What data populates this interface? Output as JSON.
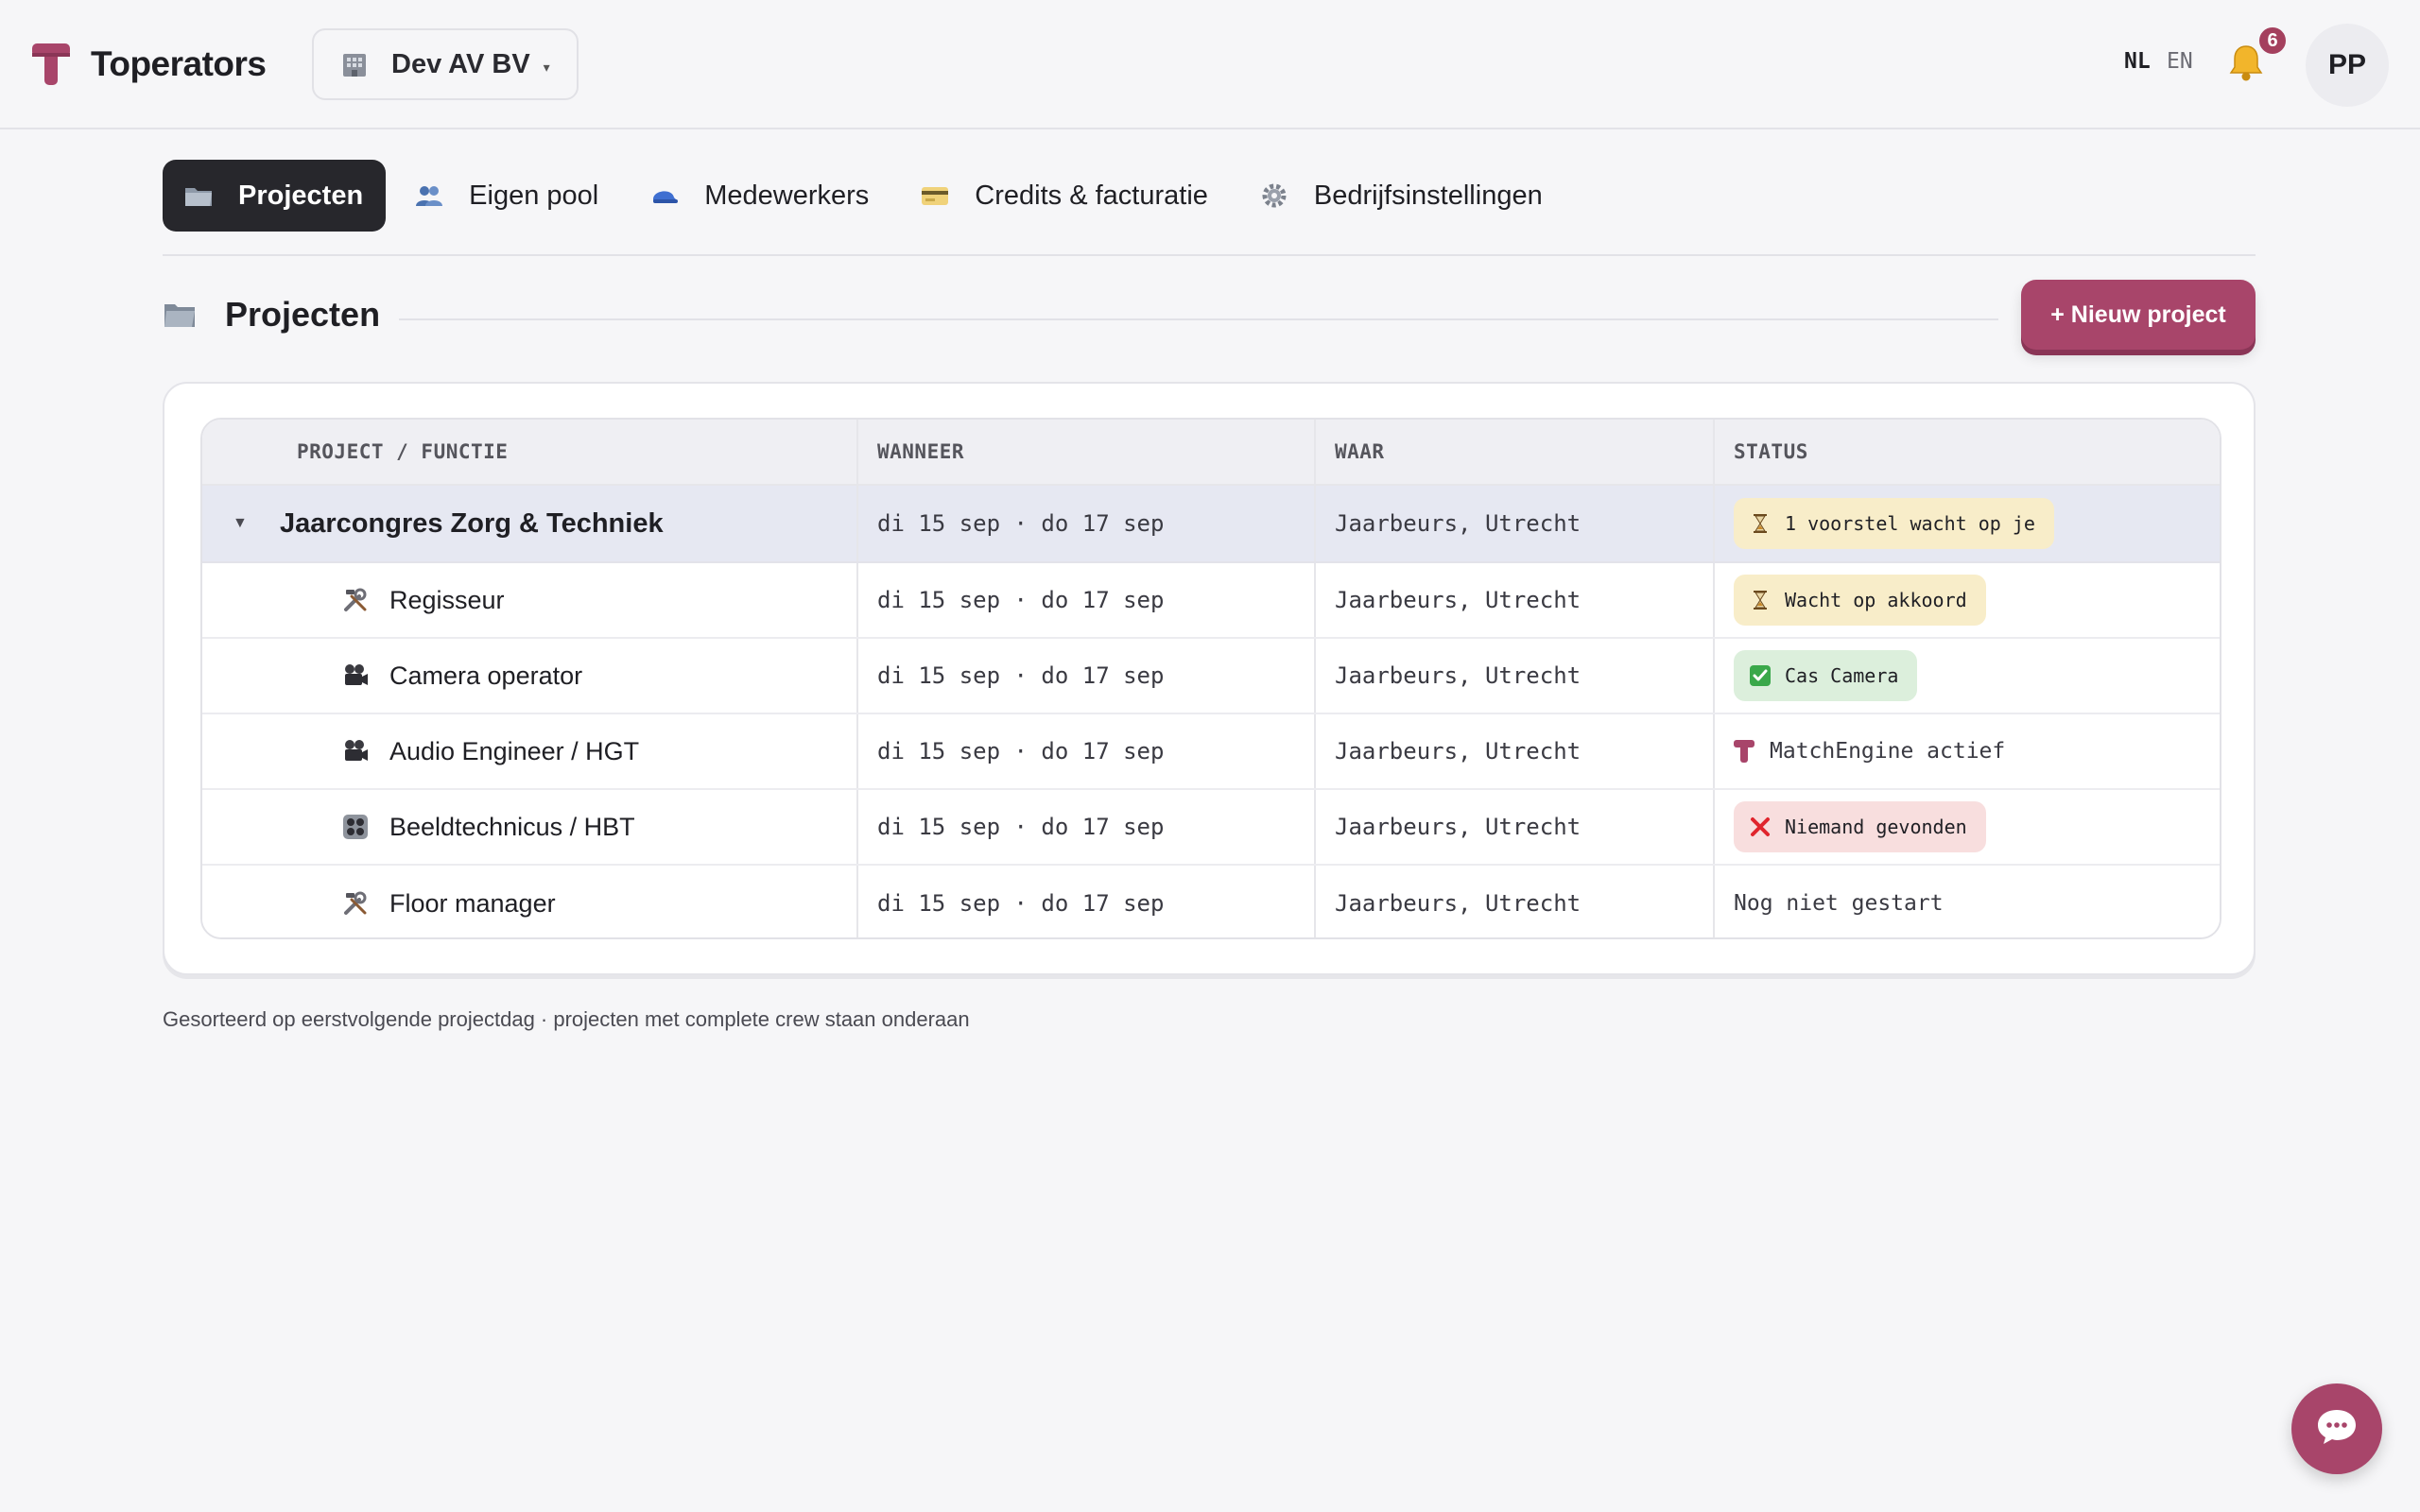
{
  "brand": {
    "name": "Toperators"
  },
  "company": {
    "name": "Dev AV BV",
    "caret": "▾"
  },
  "header": {
    "lang_nl": "NL",
    "lang_en": "EN",
    "notifications": "6",
    "avatar": "PP"
  },
  "nav": {
    "tabs": [
      {
        "label": "Projecten",
        "icon": "folder-icon",
        "active": true
      },
      {
        "label": "Eigen pool",
        "icon": "people-icon"
      },
      {
        "label": "Medewerkers",
        "icon": "cap-icon"
      },
      {
        "label": "Credits & facturatie",
        "icon": "card-icon"
      },
      {
        "label": "Bedrijfsinstellingen",
        "icon": "gear-icon"
      }
    ]
  },
  "section": {
    "title": "Projecten",
    "new_button": "+ Nieuw project"
  },
  "table": {
    "headers": [
      "PROJECT / FUNCTIE",
      "WANNEER",
      "WAAR",
      "STATUS"
    ],
    "project": {
      "caret": "▼",
      "name": "Jaarcongres Zorg & Techniek",
      "when": "di 15 sep · do 17 sep",
      "where": "Jaarbeurs, Utrecht",
      "status": "1 voorstel wacht op je",
      "status_icon": "hourglass-icon"
    },
    "functions": [
      {
        "name": "Regisseur",
        "icon": "tools-icon",
        "when": "di 15 sep · do 17 sep",
        "where": "Jaarbeurs, Utrecht",
        "status": "Wacht op akkoord",
        "status_type": "warn"
      },
      {
        "name": "Camera operator",
        "icon": "video-camera-icon",
        "when": "di 15 sep · do 17 sep",
        "where": "Jaarbeurs, Utrecht",
        "status": "Cas Camera",
        "status_type": "ok"
      },
      {
        "name": "Audio Engineer / HGT",
        "icon": "video-camera-icon",
        "when": "di 15 sep · do 17 sep",
        "where": "Jaarbeurs, Utrecht",
        "status": "MatchEngine actief",
        "status_type": "engine"
      },
      {
        "name": "Beeldtechnicus / HBT",
        "icon": "control-panel-icon",
        "when": "di 15 sep · do 17 sep",
        "where": "Jaarbeurs, Utrecht",
        "status": "Niemand gevonden",
        "status_type": "err"
      },
      {
        "name": "Floor manager",
        "icon": "tools-icon",
        "when": "di 15 sep · do 17 sep",
        "where": "Jaarbeurs, Utrecht",
        "status": "Nog niet gestart",
        "status_type": "none"
      }
    ]
  },
  "footnote": "Gesorteerd op eerstvolgende projectdag · projecten met complete crew staan onderaan",
  "colors": {
    "accent": "#a8456a",
    "dark_tab": "#27272c",
    "warn_bg": "#f8edc9",
    "ok_bg": "#dcefdc",
    "err_bg": "#f8dede"
  }
}
